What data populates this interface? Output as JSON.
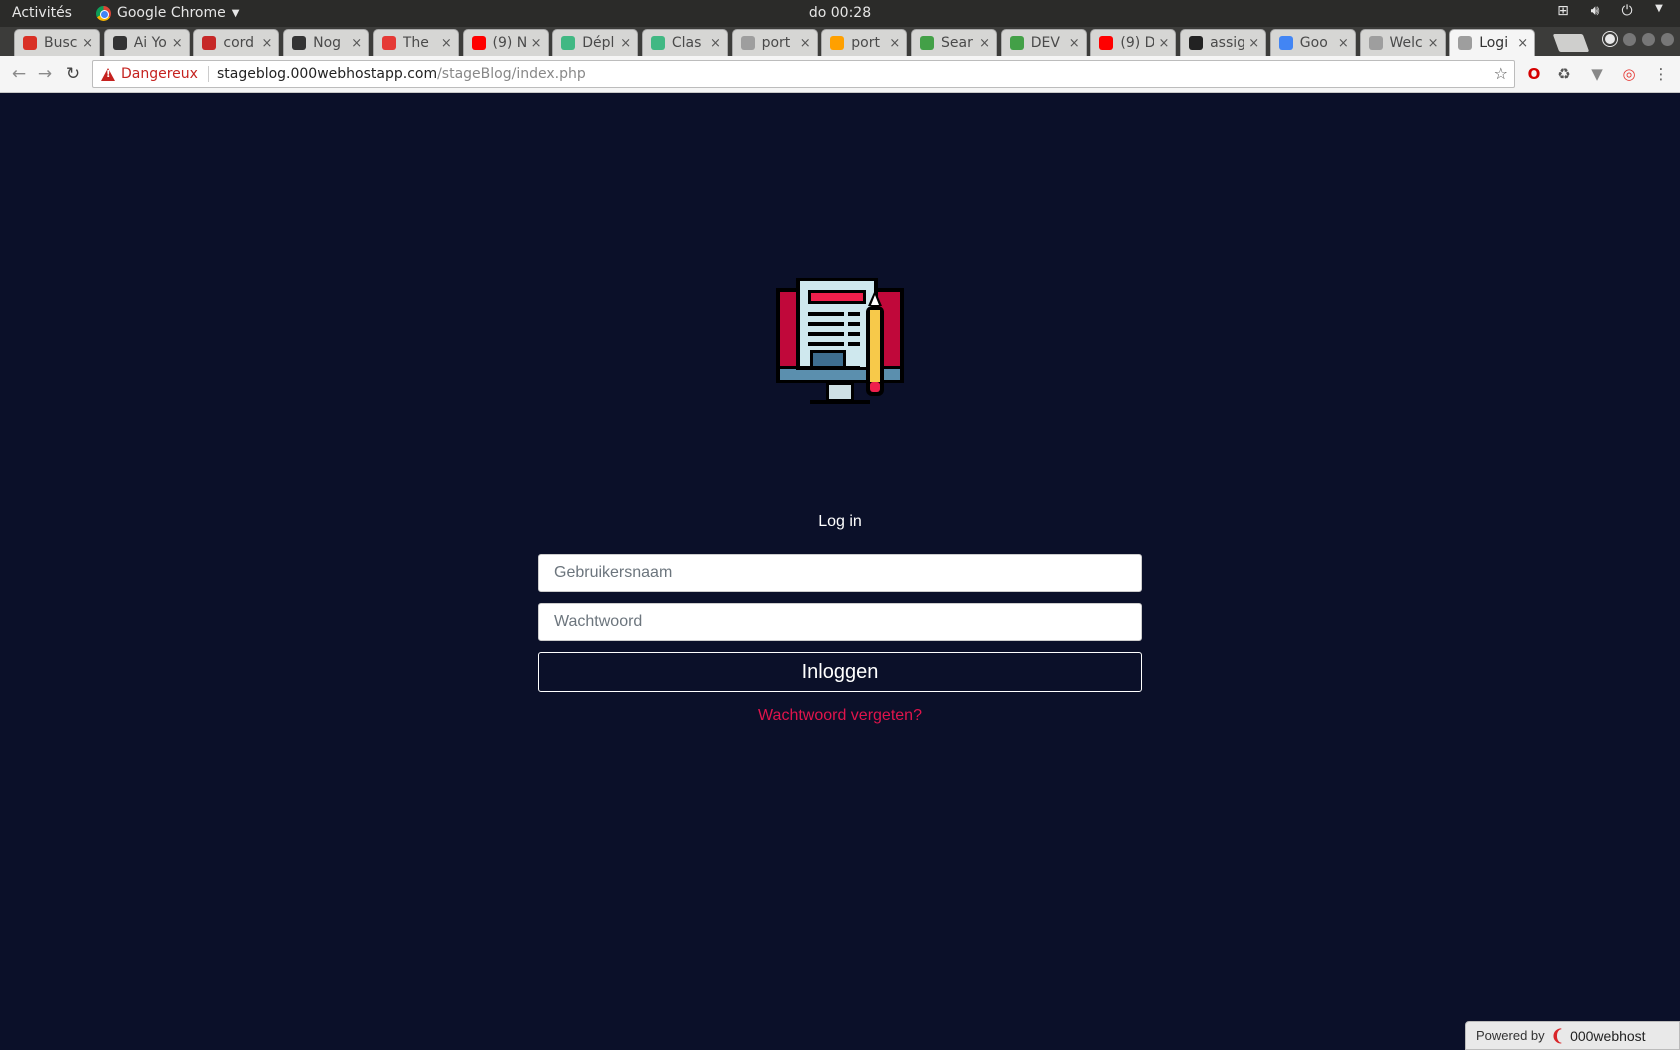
{
  "system_bar": {
    "activities": "Activités",
    "app_name": "Google Chrome",
    "clock": "do 00:28"
  },
  "tabs": [
    {
      "title": "Busc",
      "icon_color": "#d93025"
    },
    {
      "title": "Ai Yo",
      "icon_color": "#333333"
    },
    {
      "title": "cord",
      "icon_color": "#c62828"
    },
    {
      "title": "Nog",
      "icon_color": "#333333"
    },
    {
      "title": "The",
      "icon_color": "#e53935"
    },
    {
      "title": "(9) N",
      "icon_color": "#ff0000"
    },
    {
      "title": "Dépl",
      "icon_color": "#41b883"
    },
    {
      "title": "Clas",
      "icon_color": "#41b883"
    },
    {
      "title": "port",
      "icon_color": "#9e9e9e"
    },
    {
      "title": "port",
      "icon_color": "#ffa000"
    },
    {
      "title": "Sear",
      "icon_color": "#43a047"
    },
    {
      "title": "DEV",
      "icon_color": "#43a047"
    },
    {
      "title": "(9) D",
      "icon_color": "#ff0000"
    },
    {
      "title": "assig",
      "icon_color": "#222222"
    },
    {
      "title": "Goo",
      "icon_color": "#4285f4"
    },
    {
      "title": "Welc",
      "icon_color": "#9e9e9e"
    },
    {
      "title": "Logi",
      "icon_color": "#9e9e9e"
    }
  ],
  "address_bar": {
    "security_label": "Dangereux",
    "host": "stageblog.000webhostapp.com",
    "path": "/stageBlog/index.php"
  },
  "login": {
    "title": "Log in",
    "username_placeholder": "Gebruikersnaam",
    "password_placeholder": "Wachtwoord",
    "submit_label": "Inloggen",
    "forgot_link": "Wachtwoord vergeten?"
  },
  "footer": {
    "powered_by": "Powered by",
    "brand": "000webhost"
  },
  "colors": {
    "page_background": "#0b1029",
    "accent": "#e0144c"
  }
}
